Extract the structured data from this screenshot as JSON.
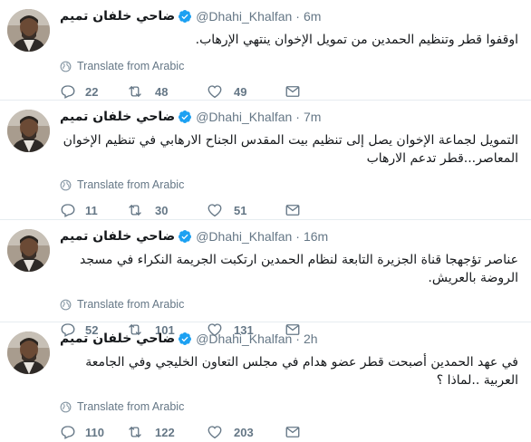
{
  "tweets": [
    {
      "name": "ضاحي خلفان تميم",
      "handle": "@Dhahi_Khalfan",
      "separator": "·",
      "time": "6m",
      "text": "اوقفوا قطر وتنظيم الحمدين من تمويل الإخوان ينتهي الإرهاب.",
      "translate": "Translate from Arabic",
      "replies": "22",
      "retweets": "48",
      "likes": "49"
    },
    {
      "name": "ضاحي خلفان تميم",
      "handle": "@Dhahi_Khalfan",
      "separator": "·",
      "time": "7m",
      "text": "التمويل لجماعة الإخوان يصل إلى تنظيم بيت المقدس الجناح الارهابي في تنظيم الإخوان المعاصر...قطر تدعم الارهاب",
      "translate": "Translate from Arabic",
      "replies": "11",
      "retweets": "30",
      "likes": "51"
    },
    {
      "name": "ضاحي خلفان تميم",
      "handle": "@Dhahi_Khalfan",
      "separator": "·",
      "time": "16m",
      "text": "عناصر تؤجهجا قناة الجزيرة التابعة لنظام الحمدين ارتكبت الجريمة النكراء في مسجد الروضة بالعريش.",
      "translate": "Translate from Arabic",
      "replies": "52",
      "retweets": "101",
      "likes": "131"
    },
    {
      "name": "ضاحي خلفان تميم",
      "handle": "@Dhahi_Khalfan",
      "separator": "·",
      "time": "2h",
      "text": "في عهد الحمدين أصبحت قطر عضو هدام في مجلس التعاون الخليجي  وفي الجامعة العربية ..لماذا ؟",
      "translate": "Translate from Arabic",
      "replies": "110",
      "retweets": "122",
      "likes": "203"
    }
  ],
  "icons": {
    "verified": "verified-badge-icon",
    "globe": "globe-icon",
    "reply": "reply-icon",
    "retweet": "retweet-icon",
    "like": "heart-icon",
    "message": "envelope-icon"
  },
  "colors": {
    "verified": "#1da1f2",
    "muted": "#657786",
    "text": "#14171a",
    "divider": "#e6ecf0"
  }
}
